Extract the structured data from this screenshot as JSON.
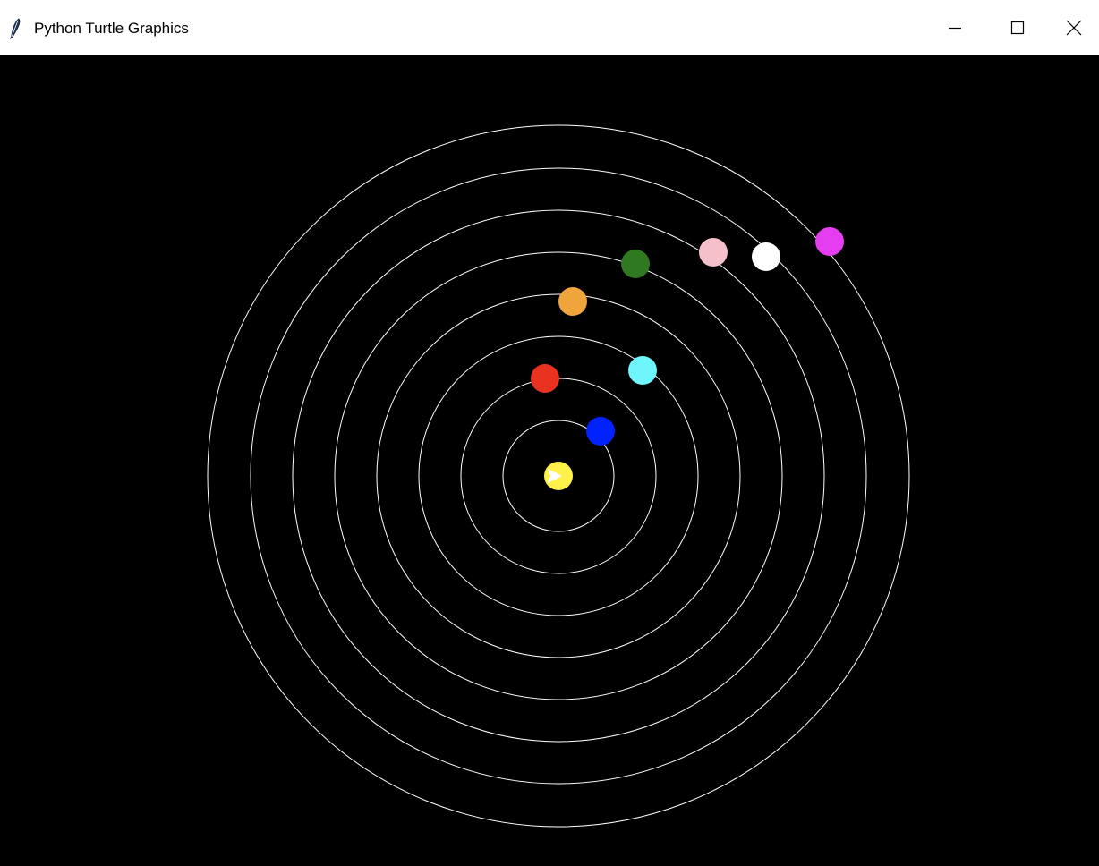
{
  "window": {
    "title": "Python Turtle Graphics",
    "app_icon": "feather-icon",
    "controls": {
      "minimize_icon": "minimize-icon",
      "maximize_icon": "maximize-icon",
      "close_icon": "close-icon"
    }
  },
  "canvas": {
    "background_color": "#000000",
    "orbit_color": "#ffffff",
    "orbit_count": 8,
    "sun": {
      "color": "#fff04a",
      "cursor_color": "#ffffff"
    },
    "planets": [
      {
        "name": "blue-planet",
        "orbit": 1,
        "color": "#0022ff"
      },
      {
        "name": "red-planet",
        "orbit": 2,
        "color": "#e93320"
      },
      {
        "name": "cyan-planet",
        "orbit": 3,
        "color": "#6ff5fc"
      },
      {
        "name": "orange-planet",
        "orbit": 4,
        "color": "#f0a43c"
      },
      {
        "name": "green-planet",
        "orbit": 5,
        "color": "#2f7920"
      },
      {
        "name": "pink-planet",
        "orbit": 6,
        "color": "#f6c0ca"
      },
      {
        "name": "white-planet",
        "orbit": 7,
        "color": "#ffffff"
      },
      {
        "name": "magenta-planet",
        "orbit": 8,
        "color": "#e53ef0"
      }
    ]
  }
}
